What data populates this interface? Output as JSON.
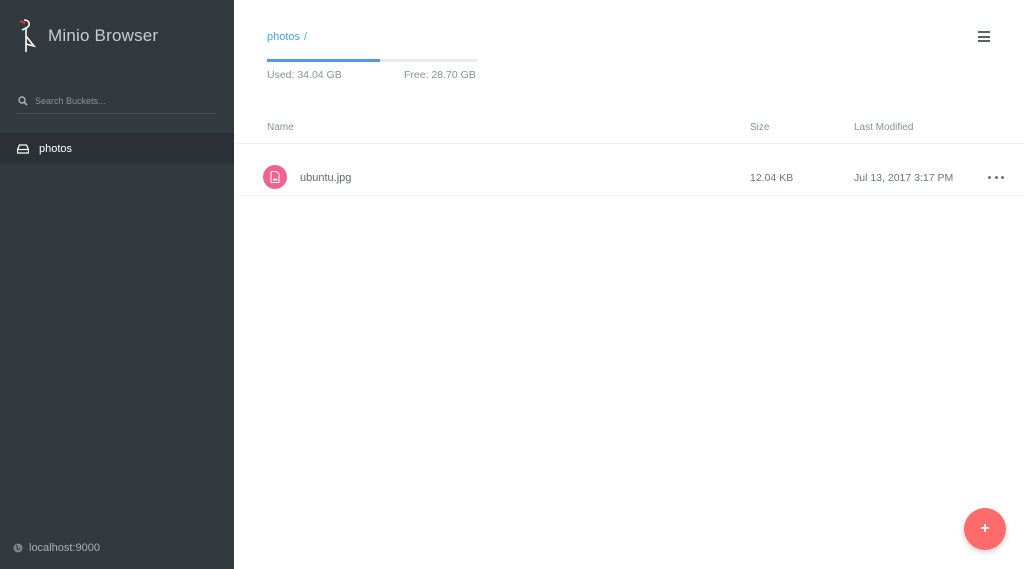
{
  "app": {
    "title": "Minio Browser",
    "logo_icon": "minio-crane-icon"
  },
  "sidebar": {
    "search": {
      "placeholder": "Search Buckets...",
      "value": "",
      "icon": "search-icon"
    },
    "buckets": [
      {
        "label": "photos",
        "icon": "drive-icon",
        "active": true
      }
    ],
    "host": {
      "label": "localhost:9000",
      "icon": "globe-icon"
    }
  },
  "main": {
    "breadcrumb": {
      "bucket": "photos",
      "separator": "/"
    },
    "storage": {
      "used_label": "Used: 34.04 GB",
      "free_label": "Free: 28.70 GB",
      "used_fraction": 0.54
    },
    "menu_icon": "hamburger-menu-icon",
    "columns": {
      "name": "Name",
      "size": "Size",
      "modified": "Last Modified"
    },
    "files": [
      {
        "name": "ubuntu.jpg",
        "size": "12.04 KB",
        "modified": "Jul 13, 2017 3:17 PM",
        "icon": "image-file-icon",
        "actions_icon": "more-horizontal-icon"
      }
    ],
    "fab": {
      "label": "+",
      "icon": "plus-icon"
    }
  },
  "colors": {
    "sidebar_bg": "#32393f",
    "sidebar_active": "#2a3035",
    "accent": "#4aa0d8",
    "file_icon": "#f06292",
    "fab": "#ff6b6b"
  }
}
